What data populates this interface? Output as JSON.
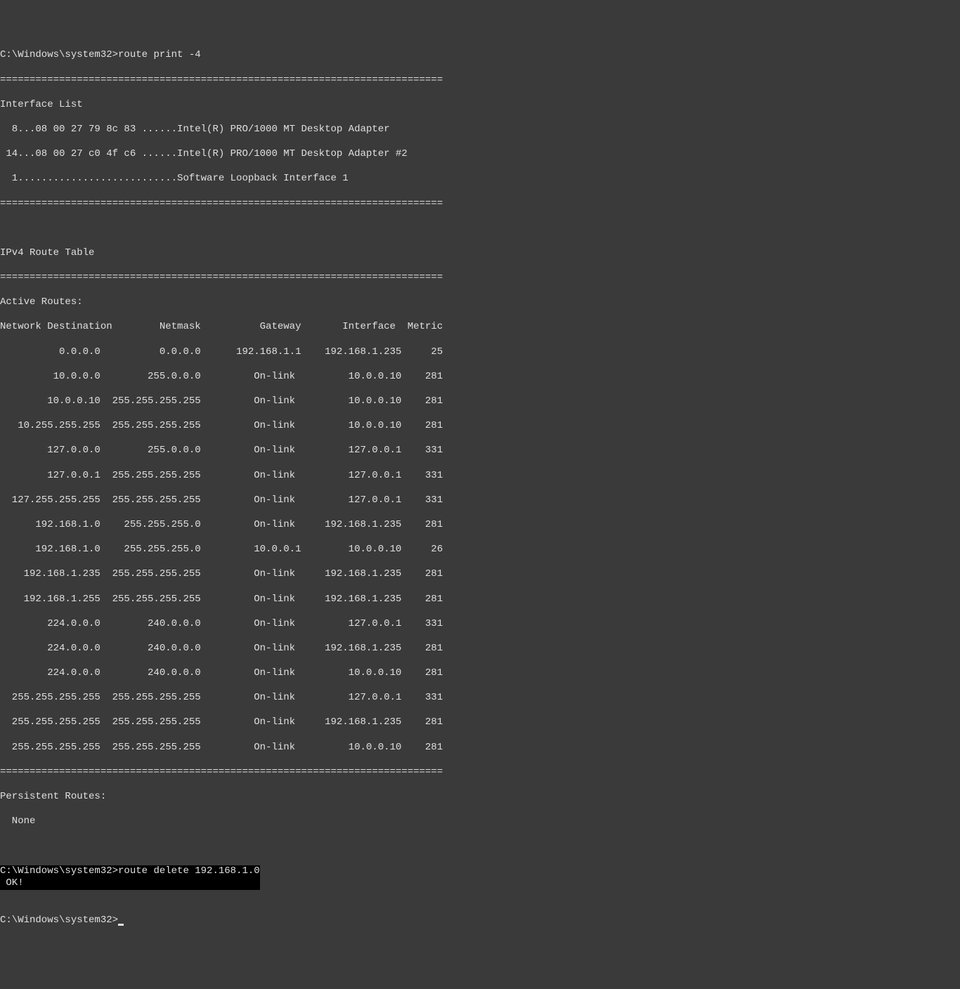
{
  "prompt1": {
    "path": "C:\\Windows\\system32>",
    "cmd": "route print -4"
  },
  "divider": "===========================================================================",
  "interface_list_header": "Interface List",
  "interfaces": [
    "  8...08 00 27 79 8c 83 ......Intel(R) PRO/1000 MT Desktop Adapter",
    " 14...08 00 27 c0 4f c6 ......Intel(R) PRO/1000 MT Desktop Adapter #2",
    "  1...........................Software Loopback Interface 1"
  ],
  "route_table_header": "IPv4 Route Table",
  "active_routes_label": "Active Routes:",
  "columns": "Network Destination        Netmask          Gateway       Interface  Metric",
  "routes": [
    "          0.0.0.0          0.0.0.0      192.168.1.1    192.168.1.235     25",
    "         10.0.0.0        255.0.0.0         On-link         10.0.0.10    281",
    "        10.0.0.10  255.255.255.255         On-link         10.0.0.10    281",
    "   10.255.255.255  255.255.255.255         On-link         10.0.0.10    281",
    "        127.0.0.0        255.0.0.0         On-link         127.0.0.1    331",
    "        127.0.0.1  255.255.255.255         On-link         127.0.0.1    331",
    "  127.255.255.255  255.255.255.255         On-link         127.0.0.1    331",
    "      192.168.1.0    255.255.255.0         On-link     192.168.1.235    281",
    "      192.168.1.0    255.255.255.0         10.0.0.1        10.0.0.10     26",
    "    192.168.1.235  255.255.255.255         On-link     192.168.1.235    281",
    "    192.168.1.255  255.255.255.255         On-link     192.168.1.235    281",
    "        224.0.0.0        240.0.0.0         On-link         127.0.0.1    331",
    "        224.0.0.0        240.0.0.0         On-link     192.168.1.235    281",
    "        224.0.0.0        240.0.0.0         On-link         10.0.0.10    281",
    "  255.255.255.255  255.255.255.255         On-link         127.0.0.1    331",
    "  255.255.255.255  255.255.255.255         On-link     192.168.1.235    281",
    "  255.255.255.255  255.255.255.255         On-link         10.0.0.10    281"
  ],
  "persistent_routes_label": "Persistent Routes:",
  "persistent_none": "  None",
  "prompt2": {
    "path": "C:\\Windows\\system32>",
    "cmd": "route delete 192.168.1.0",
    "result": " OK!"
  },
  "prompt3": {
    "path": "C:\\Windows\\system32>"
  },
  "chart_data": {
    "type": "table",
    "title": "IPv4 Route Table - Active Routes",
    "columns": [
      "Network Destination",
      "Netmask",
      "Gateway",
      "Interface",
      "Metric"
    ],
    "rows": [
      [
        "0.0.0.0",
        "0.0.0.0",
        "192.168.1.1",
        "192.168.1.235",
        25
      ],
      [
        "10.0.0.0",
        "255.0.0.0",
        "On-link",
        "10.0.0.10",
        281
      ],
      [
        "10.0.0.10",
        "255.255.255.255",
        "On-link",
        "10.0.0.10",
        281
      ],
      [
        "10.255.255.255",
        "255.255.255.255",
        "On-link",
        "10.0.0.10",
        281
      ],
      [
        "127.0.0.0",
        "255.0.0.0",
        "On-link",
        "127.0.0.1",
        331
      ],
      [
        "127.0.0.1",
        "255.255.255.255",
        "On-link",
        "127.0.0.1",
        331
      ],
      [
        "127.255.255.255",
        "255.255.255.255",
        "On-link",
        "127.0.0.1",
        331
      ],
      [
        "192.168.1.0",
        "255.255.255.0",
        "On-link",
        "192.168.1.235",
        281
      ],
      [
        "192.168.1.0",
        "255.255.255.0",
        "10.0.0.1",
        "10.0.0.10",
        26
      ],
      [
        "192.168.1.235",
        "255.255.255.255",
        "On-link",
        "192.168.1.235",
        281
      ],
      [
        "192.168.1.255",
        "255.255.255.255",
        "On-link",
        "192.168.1.235",
        281
      ],
      [
        "224.0.0.0",
        "240.0.0.0",
        "On-link",
        "127.0.0.1",
        331
      ],
      [
        "224.0.0.0",
        "240.0.0.0",
        "On-link",
        "192.168.1.235",
        281
      ],
      [
        "224.0.0.0",
        "240.0.0.0",
        "On-link",
        "10.0.0.10",
        281
      ],
      [
        "255.255.255.255",
        "255.255.255.255",
        "On-link",
        "127.0.0.1",
        331
      ],
      [
        "255.255.255.255",
        "255.255.255.255",
        "On-link",
        "192.168.1.235",
        281
      ],
      [
        "255.255.255.255",
        "255.255.255.255",
        "On-link",
        "10.0.0.10",
        281
      ]
    ]
  }
}
